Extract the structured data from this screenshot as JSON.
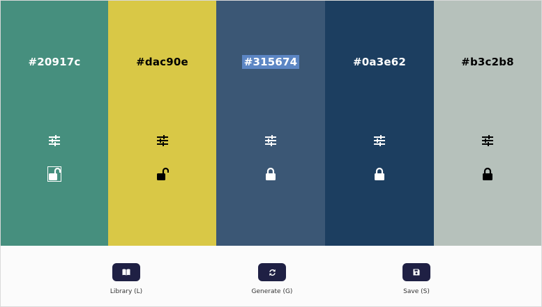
{
  "palette": {
    "swatches": [
      {
        "hex": "#20917c",
        "display_color": "#468f7e",
        "text_color": "#ffffff",
        "locked": false
      },
      {
        "hex": "#dac90e",
        "display_color": "#d9c846",
        "text_color": "#000000",
        "locked": false
      },
      {
        "hex": "#315674",
        "display_color": "#3b5775",
        "text_color": "#ffffff",
        "locked": true
      },
      {
        "hex": "#0a3e62",
        "display_color": "#1c3e60",
        "text_color": "#ffffff",
        "locked": true
      },
      {
        "hex": "#b3c2b8",
        "display_color": "#b6c1bb",
        "text_color": "#000000",
        "locked": true
      }
    ]
  },
  "toolbar": {
    "library_label": "Library (L)",
    "generate_label": "Generate (G)",
    "save_label": "Save (S)"
  },
  "icons": {
    "adjust": "sliders-icon",
    "lock": "padlock-icon",
    "library": "book-icon",
    "generate": "refresh-icon",
    "save": "floppy-disk-icon"
  }
}
